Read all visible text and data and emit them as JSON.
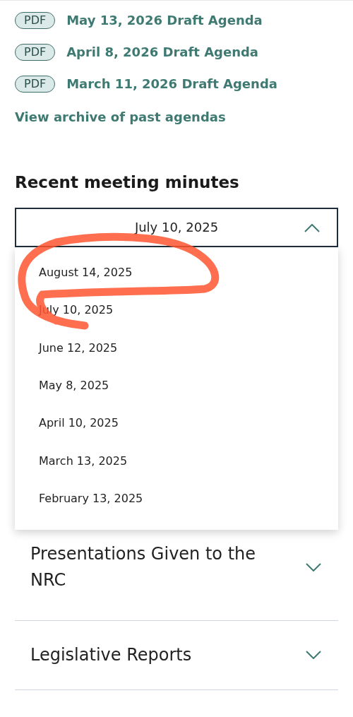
{
  "agendas": [
    {
      "badge": "PDF",
      "title": "May 13, 2026 Draft Agenda"
    },
    {
      "badge": "PDF",
      "title": "April 8, 2026 Draft Agenda"
    },
    {
      "badge": "PDF",
      "title": "March 11, 2026 Draft Agenda"
    }
  ],
  "archive_link": "View archive of past agendas",
  "minutes": {
    "heading": "Recent meeting minutes",
    "value": "July 10, 2025",
    "expanded": true,
    "options": [
      "August 14, 2025",
      "July 10, 2025",
      "June 12, 2025",
      "May 8, 2025",
      "April 10, 2025",
      "March 13, 2025",
      "February 13, 2025"
    ]
  },
  "accordion": [
    {
      "title": "Presentations Given to the NRC",
      "expanded": false
    },
    {
      "title": "Legislative Reports",
      "expanded": false
    }
  ]
}
